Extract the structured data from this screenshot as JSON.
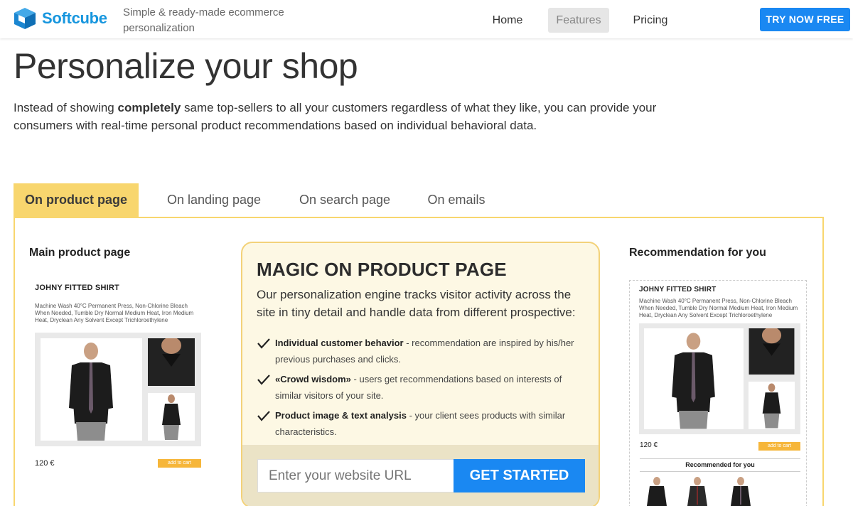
{
  "header": {
    "brand": "Softcube",
    "tagline": "Simple & ready-made ecommerce personalization",
    "nav": {
      "home": "Home",
      "features": "Features",
      "pricing": "Pricing"
    },
    "cta": "TRY NOW FREE",
    "logo_icon": "cube-logo-icon",
    "brand_color": "#1796de"
  },
  "hero": {
    "title": "Personalize your shop",
    "desc_before": "Instead of showing ",
    "desc_bold": "completely",
    "desc_after": " same top-sellers to all your customers regardless of what they like, you can provide your consumers with real-time personal product recommendations based on individual behavioral data."
  },
  "tabs": [
    "On product page",
    "On landing page",
    "On search page",
    "On emails"
  ],
  "left": {
    "title": "Main product page",
    "product_name": "JOHNY FITTED SHIRT",
    "product_desc": "Machine Wash 40°C Permanent Press, Non-Chlorine Bleach When Needed, Tumble Dry Normal Medium Heat, Iron Medium Heat, Dryclean Any Solvent Except Trichloroethylene",
    "price": "120 €",
    "cart": "add to cart"
  },
  "magic": {
    "title": "MAGIC ON PRODUCT PAGE",
    "subtitle": "Our personalization engine tracks visitor activity across the site in tiny detail and handle data from different prospective:",
    "items": [
      {
        "bold": "Individual customer behavior",
        "text": " - recommendation are inspired by his/her previous purchases and clicks."
      },
      {
        "bold": "«Crowd wisdom»",
        "text": " - users get recommendations based on interests of similar visitors of your site."
      },
      {
        "bold": "Product image & text analysis",
        "text": " - your client sees products with similar characteristics."
      }
    ],
    "url_placeholder": "Enter your website URL",
    "button": "GET STARTED"
  },
  "right": {
    "title": "Recommendation for you",
    "product_name": "JOHNY FITTED SHIRT",
    "product_desc": "Machine Wash 40°C Permanent Press, Non-Chlorine Bleach When Needed, Tumble Dry Normal Medium Heat, Iron Medium Heat, Dryclean Any Solvent Except Trichloroethylene",
    "price": "120 €",
    "cart": "add to cart",
    "recommended": "Recommended for you"
  },
  "colors": {
    "accent_yellow": "#f8d66e",
    "button_blue": "#1a88f2",
    "cart_orange": "#f6b63a"
  }
}
